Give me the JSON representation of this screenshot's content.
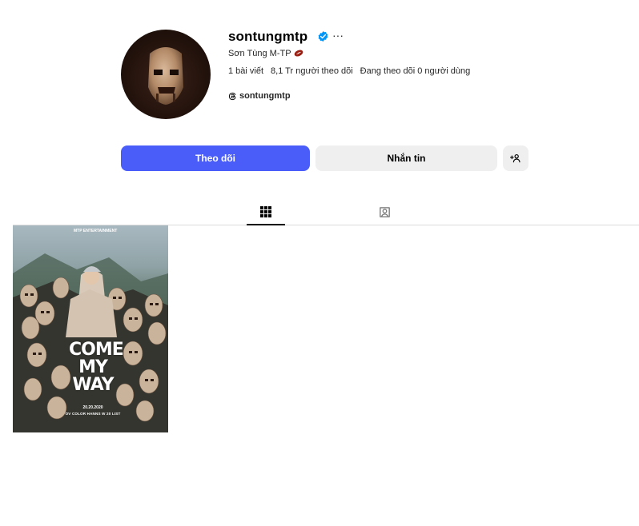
{
  "profile": {
    "username": "sontungmtp",
    "verified": true,
    "more_label": "···",
    "full_name": "Sơn Tùng M-TP",
    "name_emoji": "rugby-ball-icon",
    "stats": {
      "posts": "1 bài viết",
      "followers": "8,1 Tr người theo dõi",
      "following": "Đang theo dõi 0 người dùng"
    },
    "threads_handle": "sontungmtp"
  },
  "actions": {
    "follow": "Theo dõi",
    "message": "Nhắn tin",
    "add_user_icon": "add-user-icon"
  },
  "tabs": [
    {
      "name": "posts",
      "icon": "grid-icon",
      "active": true
    },
    {
      "name": "tagged",
      "icon": "tagged-user-icon",
      "active": false
    }
  ],
  "posts": [
    {
      "title_lines": [
        "COME",
        "MY",
        "WAY"
      ],
      "date_text": "20.20.2020",
      "caption_line": "OV COLOR HANNS W 20 LIST",
      "logo_text": "MTP ENTERTAINMENT"
    }
  ],
  "colors": {
    "follow_button": "#4a5df9",
    "secondary_button": "#efefef",
    "verified_badge": "#0095f6"
  }
}
